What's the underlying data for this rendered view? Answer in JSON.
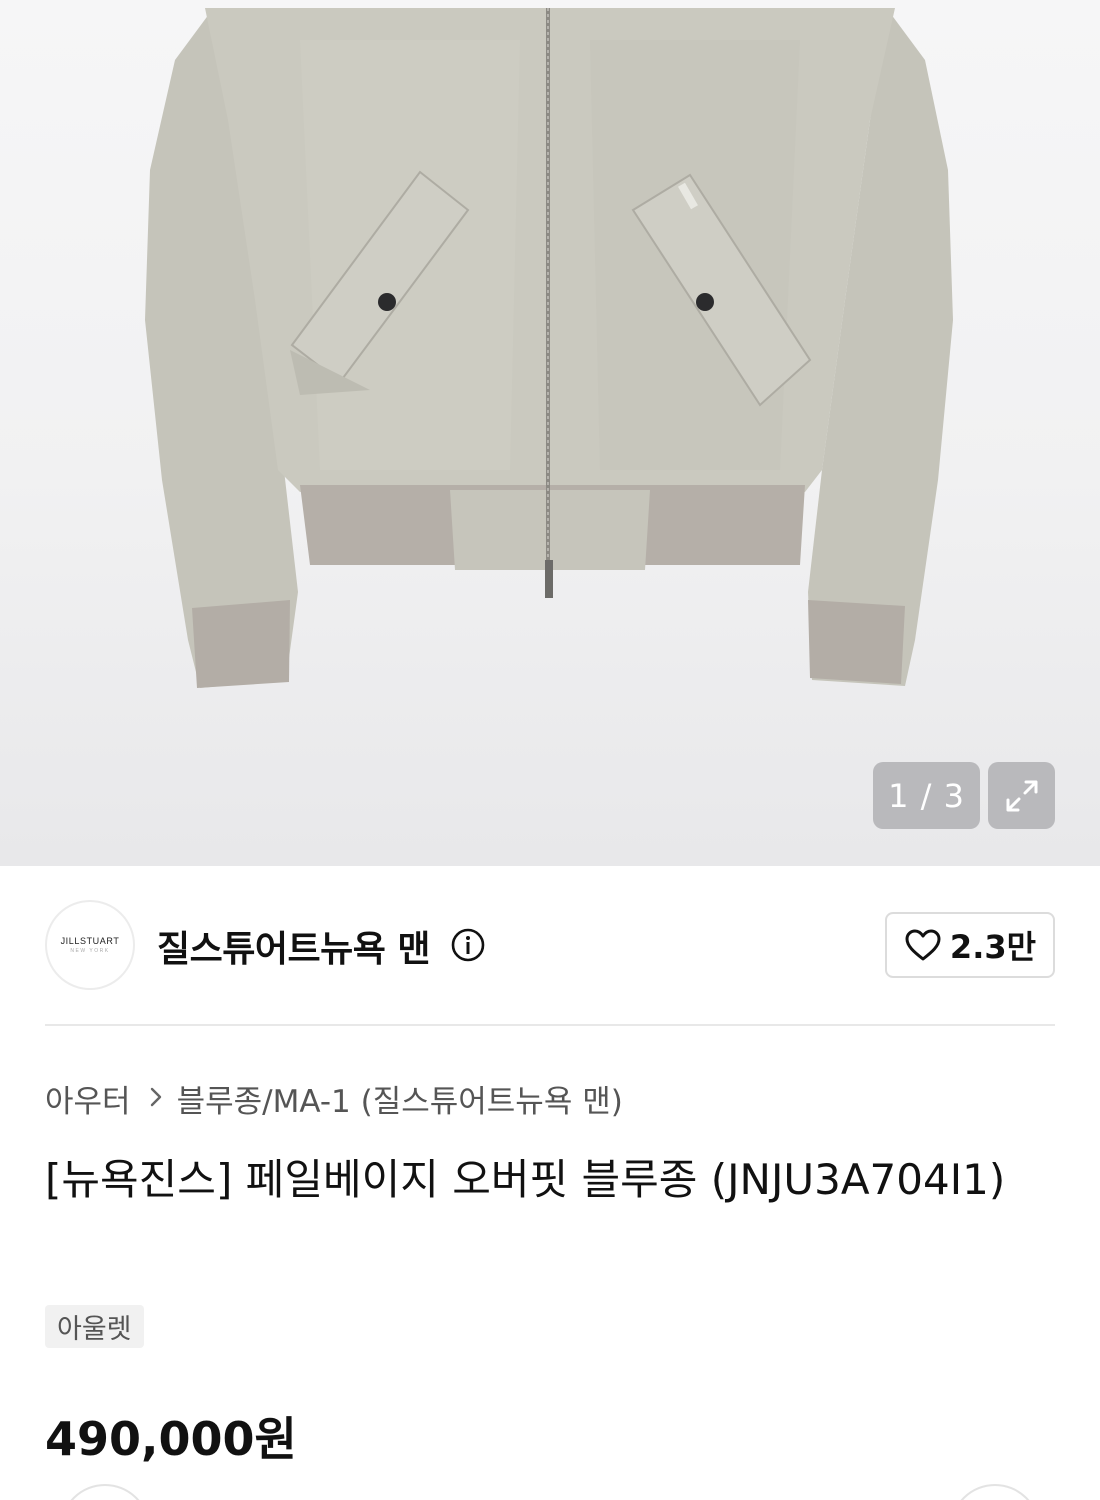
{
  "gallery": {
    "image_alt": "pale beige overfit bomber jacket",
    "counter": "1 / 3",
    "expand_icon": "expand-icon"
  },
  "brand": {
    "logo_text": "JILLSTUART",
    "logo_sub": "NEW YORK",
    "name": "질스튜어트뉴욕 맨",
    "info_icon": "info-icon"
  },
  "like": {
    "icon": "heart-icon",
    "count": "2.3만"
  },
  "category": {
    "parent": "아우터",
    "separator_icon": "chevron-right-icon",
    "child": "블루종/MA-1 (질스튜어트뉴욕 맨)"
  },
  "product": {
    "title": "[뉴욕진스] 페일베이지 오버핏 블루종 (JNJU3A704I1)",
    "badge": "아울렛",
    "price": "490,000원"
  },
  "colors": {
    "jacket": "#c8c7bd",
    "ribbing": "#b3ada6",
    "overlay": "#b9b9bc"
  }
}
